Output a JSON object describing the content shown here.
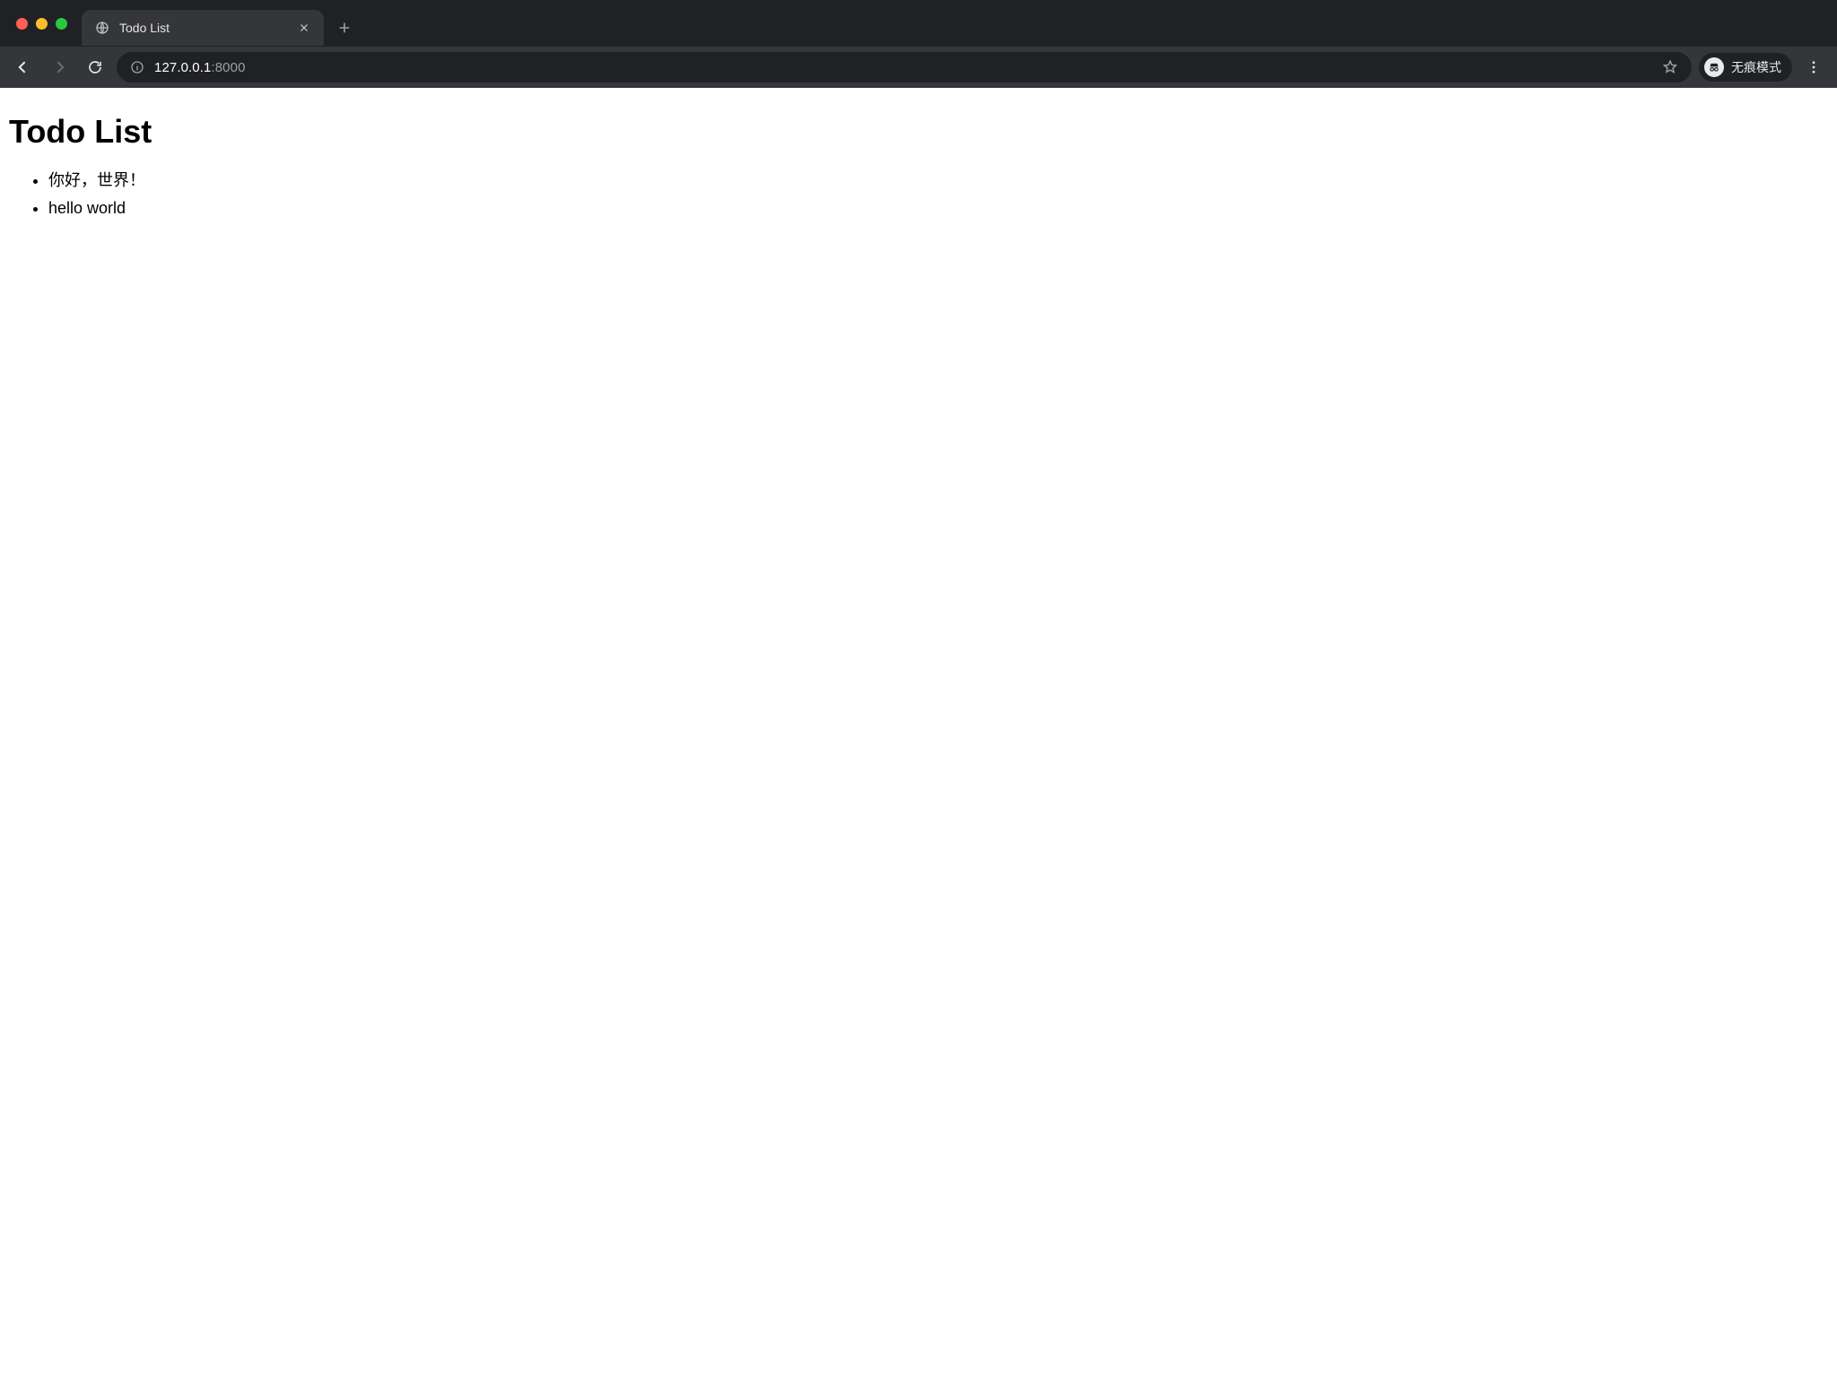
{
  "browser": {
    "tab_title": "Todo List",
    "url_host": "127.0.0.1",
    "url_port": ":8000",
    "incognito_label": "无痕模式"
  },
  "page": {
    "heading": "Todo List",
    "items": [
      "你好，世界！",
      "hello world"
    ]
  }
}
